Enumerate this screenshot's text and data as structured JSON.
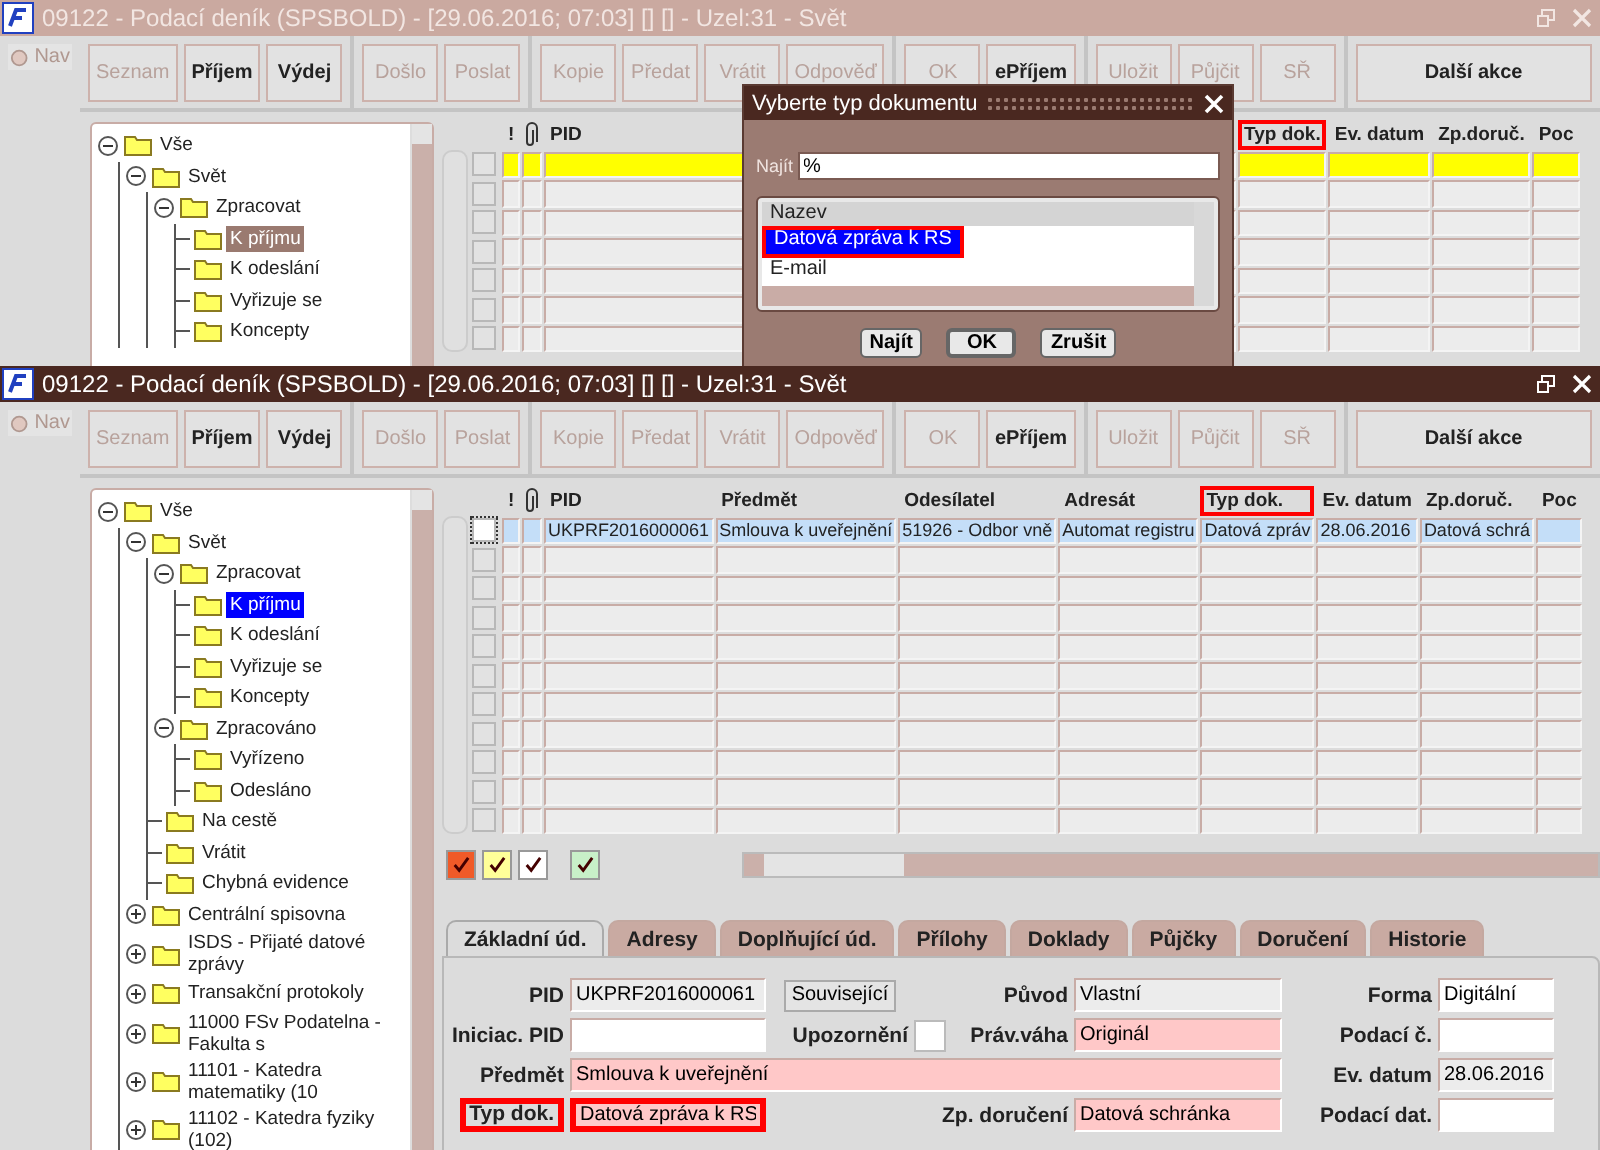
{
  "windows": [
    {
      "kind": "partial",
      "active": false,
      "title": "09122 - Podací deník (SPSBOLD) - [29.06.2016; 07:03] [] [] - Uzel:31 - Svět",
      "nav": "Nav",
      "toolbar": [
        [
          {
            "label": "Seznam",
            "disabled": true
          },
          {
            "label": "Příjem",
            "disabled": false
          },
          {
            "label": "Výdej",
            "disabled": false
          }
        ],
        [
          {
            "label": "Došlo",
            "disabled": true
          },
          {
            "label": "Poslat",
            "disabled": true
          }
        ],
        [
          {
            "label": "Kopie",
            "disabled": true
          },
          {
            "label": "Předat",
            "disabled": true
          },
          {
            "label": "Vrátit",
            "disabled": true
          },
          {
            "label": "Odpověď",
            "disabled": true
          }
        ],
        [
          {
            "label": "OK",
            "disabled": true
          },
          {
            "label": "ePříjem",
            "disabled": false
          }
        ],
        [
          {
            "label": "Uložit",
            "disabled": true
          },
          {
            "label": "Půjčit",
            "disabled": true
          },
          {
            "label": "SŘ",
            "disabled": true
          }
        ],
        [
          {
            "label": "Další akce",
            "disabled": false
          }
        ]
      ],
      "tree": [
        {
          "label": "Vše",
          "selected": false,
          "expanded": true,
          "children": [
            {
              "label": "Svět",
              "selected": false,
              "expanded": true,
              "children": [
                {
                  "label": "Zpracovat",
                  "selected": false,
                  "expanded": true,
                  "children": [
                    {
                      "label": "K příjmu",
                      "selected": true
                    },
                    {
                      "label": "K odeslání",
                      "selected": false
                    },
                    {
                      "label": "Vyřizuje se",
                      "selected": false
                    },
                    {
                      "label": "Koncepty",
                      "selected": false
                    }
                  ]
                }
              ]
            }
          ]
        }
      ],
      "table": {
        "columns": [
          {
            "kind": "flag",
            "label": "!",
            "highlighted": false
          },
          {
            "kind": "attachment",
            "highlighted": false
          },
          {
            "kind": "text",
            "label": "PID",
            "highlighted": false
          },
          {
            "kind": "text",
            "label": "Typ dok.",
            "highlighted": true
          },
          {
            "kind": "text",
            "label": "Ev. datum",
            "highlighted": false
          },
          {
            "kind": "text",
            "label": "Zp.doruč.",
            "highlighted": false
          },
          {
            "kind": "text",
            "label": "Poc",
            "highlighted": false
          }
        ],
        "rows": [
          {
            "selected": true,
            "checked": false
          },
          {
            "selected": false,
            "checked": false
          },
          {
            "selected": false,
            "checked": false
          },
          {
            "selected": false,
            "checked": false
          },
          {
            "selected": false,
            "checked": false
          },
          {
            "selected": false,
            "checked": false
          },
          {
            "selected": false,
            "checked": false
          }
        ]
      },
      "dialog": {
        "title": "Vyberte typ dokumentu",
        "search_label": "Najít",
        "search_value": "%",
        "list_header": "Nazev",
        "items": [
          {
            "label": "Datová zpráva k RS",
            "selected": true,
            "highlighted": true
          },
          {
            "label": "E-mail",
            "selected": false,
            "highlighted": false
          }
        ],
        "buttons": [
          {
            "label": "Najít",
            "default": false
          },
          {
            "label": "OK",
            "default": true
          },
          {
            "label": "Zrušit",
            "default": false
          }
        ]
      }
    },
    {
      "kind": "full",
      "active": true,
      "title": "09122 - Podací deník (SPSBOLD) - [29.06.2016; 07:03] [] [] - Uzel:31 - Svět",
      "nav": "Nav",
      "toolbar": [
        [
          {
            "label": "Seznam",
            "disabled": true
          },
          {
            "label": "Příjem",
            "disabled": false
          },
          {
            "label": "Výdej",
            "disabled": false
          }
        ],
        [
          {
            "label": "Došlo",
            "disabled": true
          },
          {
            "label": "Poslat",
            "disabled": true
          }
        ],
        [
          {
            "label": "Kopie",
            "disabled": true
          },
          {
            "label": "Předat",
            "disabled": true
          },
          {
            "label": "Vrátit",
            "disabled": true
          },
          {
            "label": "Odpověď",
            "disabled": true
          }
        ],
        [
          {
            "label": "OK",
            "disabled": true
          },
          {
            "label": "ePříjem",
            "disabled": false
          }
        ],
        [
          {
            "label": "Uložit",
            "disabled": true
          },
          {
            "label": "Půjčit",
            "disabled": true
          },
          {
            "label": "SŘ",
            "disabled": true
          }
        ],
        [
          {
            "label": "Další akce",
            "disabled": false
          }
        ]
      ],
      "tree": [
        {
          "label": "Vše",
          "selected": false,
          "expanded": true,
          "children": [
            {
              "label": "Svět",
              "selected": false,
              "expanded": true,
              "children": [
                {
                  "label": "Zpracovat",
                  "selected": false,
                  "expanded": true,
                  "children": [
                    {
                      "label": "K příjmu",
                      "selected": true
                    },
                    {
                      "label": "K odeslání",
                      "selected": false
                    },
                    {
                      "label": "Vyřizuje se",
                      "selected": false
                    },
                    {
                      "label": "Koncepty",
                      "selected": false
                    }
                  ]
                },
                {
                  "label": "Zpracováno",
                  "selected": false,
                  "expanded": true,
                  "children": [
                    {
                      "label": "Vyřízeno",
                      "selected": false
                    },
                    {
                      "label": "Odesláno",
                      "selected": false
                    }
                  ]
                },
                {
                  "label": "Na cestě",
                  "selected": false
                },
                {
                  "label": "Vrátit",
                  "selected": false
                },
                {
                  "label": "Chybná evidence",
                  "selected": false
                }
              ]
            },
            {
              "label": "Centrální spisovna",
              "selected": false,
              "expanded": false
            },
            {
              "label": "ISDS - Přijaté datové zprávy",
              "selected": false,
              "expanded": false
            },
            {
              "label": "Transakční protokoly",
              "selected": false,
              "expanded": false
            },
            {
              "label": "11000 FSv Podatelna - Fakulta s",
              "selected": false,
              "expanded": false
            },
            {
              "label": "11101 - Katedra matematiky (10",
              "selected": false,
              "expanded": false
            },
            {
              "label": "11102 - Katedra fyziky (102)",
              "selected": false,
              "expanded": false
            }
          ]
        }
      ],
      "table": {
        "columns": [
          {
            "kind": "flag",
            "label": "!",
            "highlighted": false
          },
          {
            "kind": "attachment",
            "highlighted": false
          },
          {
            "kind": "text",
            "label": "PID",
            "highlighted": false
          },
          {
            "kind": "text",
            "label": "Předmět",
            "highlighted": false
          },
          {
            "kind": "text",
            "label": "Odesílatel",
            "highlighted": false
          },
          {
            "kind": "text",
            "label": "Adresát",
            "highlighted": false
          },
          {
            "kind": "text",
            "label": "Typ dok.",
            "highlighted": true
          },
          {
            "kind": "text",
            "label": "Ev. datum",
            "highlighted": false
          },
          {
            "kind": "text",
            "label": "Zp.doruč.",
            "highlighted": false
          },
          {
            "kind": "text",
            "label": "Poc",
            "highlighted": false
          }
        ],
        "rows": [
          {
            "selected": true,
            "checked": false,
            "cells": [
              "UKPRF2016000061",
              "Smlouva k uveřejnění",
              "51926 - Odbor vně",
              "Automat registru",
              "Datová zpráv",
              "28.06.2016",
              "Datová schrá"
            ]
          },
          {
            "selected": false,
            "checked": false
          },
          {
            "selected": false,
            "checked": false
          },
          {
            "selected": false,
            "checked": false
          },
          {
            "selected": false,
            "checked": false
          },
          {
            "selected": false,
            "checked": false
          },
          {
            "selected": false,
            "checked": false
          },
          {
            "selected": false,
            "checked": false
          },
          {
            "selected": false,
            "checked": false
          },
          {
            "selected": false,
            "checked": false
          },
          {
            "selected": false,
            "checked": false
          }
        ]
      },
      "filters": [
        {
          "checked": true,
          "color": "#f05a28"
        },
        {
          "checked": true,
          "color": "#ffff99"
        },
        {
          "checked": true,
          "color": "#ffffff"
        },
        {
          "checked": true,
          "color": "#c8f0c8"
        }
      ],
      "tabs": [
        {
          "label": "Základní úd.",
          "selected": true
        },
        {
          "label": "Adresy",
          "selected": false
        },
        {
          "label": "Doplňující úd.",
          "selected": false
        },
        {
          "label": "Přílohy",
          "selected": false
        },
        {
          "label": "Doklady",
          "selected": false
        },
        {
          "label": "Půjčky",
          "selected": false
        },
        {
          "label": "Doručení",
          "selected": false
        },
        {
          "label": "Historie",
          "selected": false
        }
      ],
      "form": [
        {
          "left": {
            "label": "PID",
            "value": "UKPRF2016000061",
            "readonly": true,
            "required": false
          },
          "middle": {
            "kind": "button",
            "label": "Související"
          },
          "right": {
            "label": "Původ",
            "value": "Vlastní",
            "readonly": true,
            "required": false
          },
          "far": {
            "label": "Forma",
            "value": "Digitální",
            "readonly": false,
            "required": false
          }
        },
        {
          "left": {
            "label": "Iniciac. PID",
            "readonly": false,
            "required": false
          },
          "middle": {
            "kind": "checkbox",
            "label": "Upozornění",
            "checked": false
          },
          "right": {
            "label": "Práv.váha",
            "value": "Originál",
            "readonly": false,
            "required": true
          },
          "far": {
            "label": "Podací č.",
            "readonly": false,
            "required": false
          }
        },
        {
          "left": {
            "label": "Předmět",
            "value": "Smlouva k uveřejnění",
            "readonly": false,
            "required": true
          },
          "far": {
            "label": "Ev. datum",
            "value": "28.06.2016",
            "readonly": true,
            "required": false
          }
        },
        {
          "left": {
            "label": "Typ dok.",
            "value": "Datová zpráva k RS",
            "readonly": false,
            "required": true,
            "highlighted": true
          },
          "right": {
            "label": "Zp. doručení",
            "value": "Datová schránka",
            "readonly": false,
            "required": true
          },
          "far": {
            "label": "Podací dat.",
            "readonly": false,
            "required": false
          }
        }
      ]
    }
  ]
}
